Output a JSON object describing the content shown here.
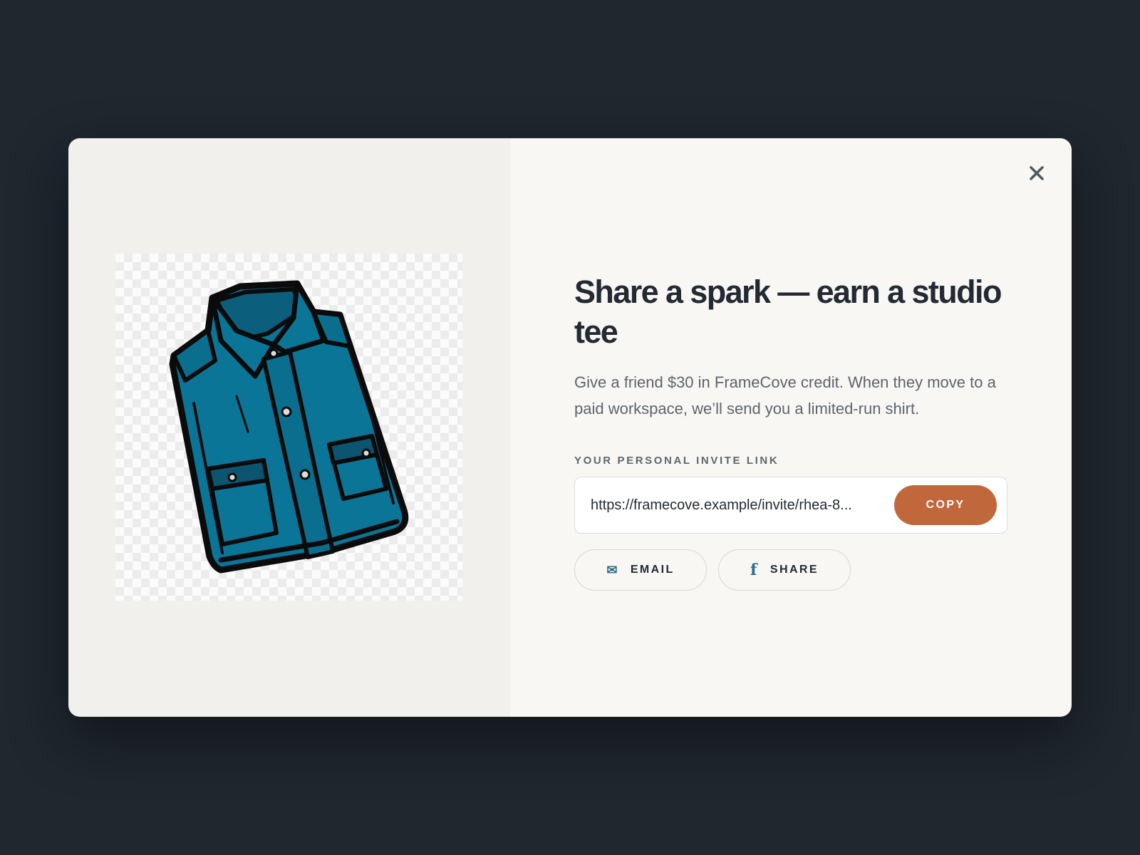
{
  "modal": {
    "title": "Share a spark — earn a studio tee",
    "description": "Give a friend $30 in FrameCove credit. When they move to a paid workspace, we’ll send you a limited-run shirt.",
    "invite_label": "YOUR PERSONAL INVITE LINK",
    "invite_link": "https://framecove.example/invite/rhea-8...",
    "copy_label": "COPY",
    "email_label": "EMAIL",
    "share_label": "SHARE",
    "icons": {
      "close": "close-icon",
      "email": "envelope-icon",
      "share": "facebook-icon"
    }
  },
  "colors": {
    "backdrop": "#1f272f",
    "accent": "#c0673b",
    "shirt": "#0a7597",
    "text_dark": "#232a33"
  }
}
